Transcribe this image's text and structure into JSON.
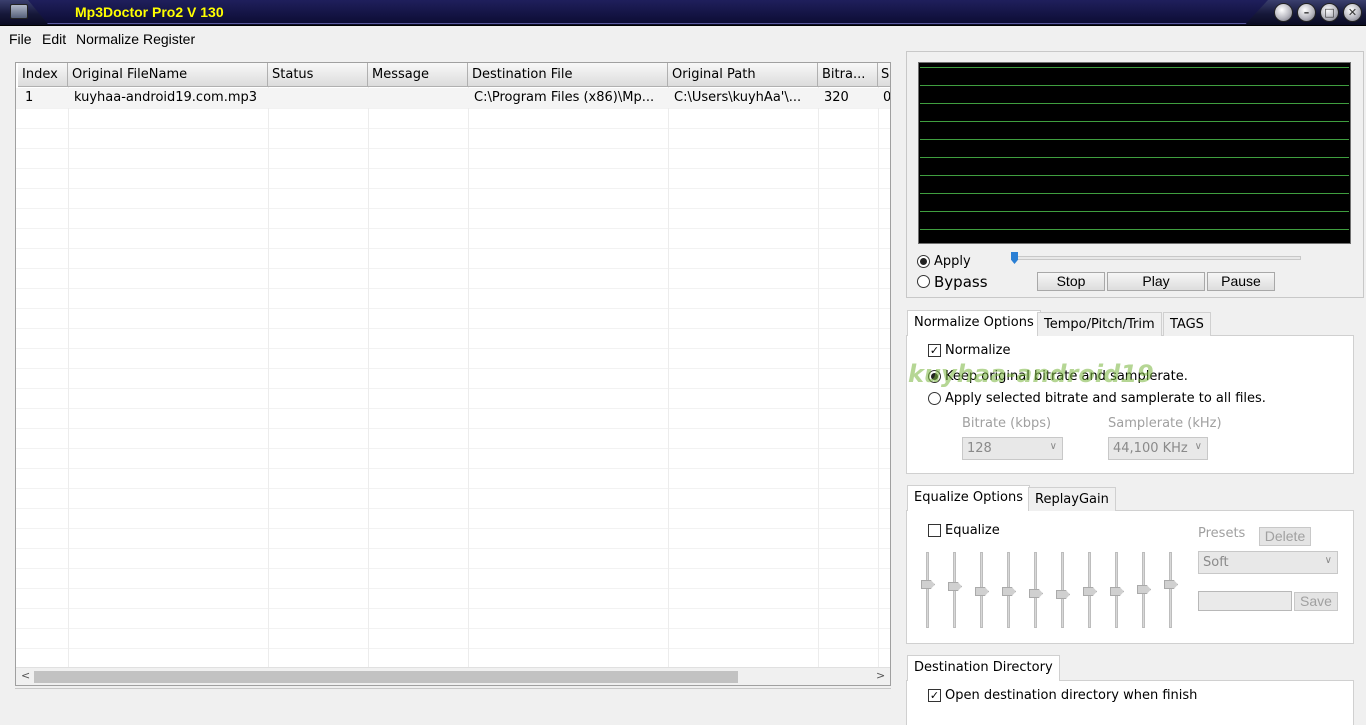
{
  "window": {
    "title": "Mp3Doctor Pro2 V 130"
  },
  "menu": [
    "File",
    "Edit",
    "Normalize",
    "Register"
  ],
  "grid": {
    "columns": [
      "Index",
      "Original FileName",
      "Status",
      "Message",
      "Destination File",
      "Original Path",
      "Bitra...",
      "S"
    ],
    "rows": [
      [
        "1",
        "kuyhaa-android19.com.mp3",
        "",
        "",
        "C:\\Program Files (x86)\\Mp...",
        "C:\\Users\\kuyhAa'\\...",
        "320",
        "0"
      ]
    ]
  },
  "player": {
    "apply_label": "Apply",
    "bypass_label": "Bypass",
    "mode_selected": "Apply",
    "stop_label": "Stop",
    "play_label": "Play",
    "pause_label": "Pause",
    "position": 0
  },
  "normalize_tabs": [
    "Normalize Options",
    "Tempo/Pitch/Trim",
    "TAGS"
  ],
  "normalize": {
    "normalize_label": "Normalize",
    "normalize_checked": true,
    "keep_label": "Keep original bitrate and samplerate.",
    "apply_all_label": "Apply selected bitrate and samplerate to all files.",
    "selected_option": "keep",
    "bitrate_label": "Bitrate (kbps)",
    "bitrate_value": "128",
    "samplerate_label": "Samplerate (kHz)",
    "samplerate_value": "44,100  KHz"
  },
  "equalize_tabs": [
    "Equalize Options",
    "ReplayGain"
  ],
  "equalize": {
    "equalize_label": "Equalize",
    "equalize_checked": false,
    "presets_label": "Presets",
    "delete_label": "Delete",
    "preset_value": "Soft",
    "save_label": "Save",
    "preset_name_value": "",
    "band_count": 10
  },
  "destination": {
    "tab_label": "Destination Directory",
    "open_label": "Open destination directory when finish",
    "open_checked": true
  },
  "watermark": "kuyhaa-android19"
}
